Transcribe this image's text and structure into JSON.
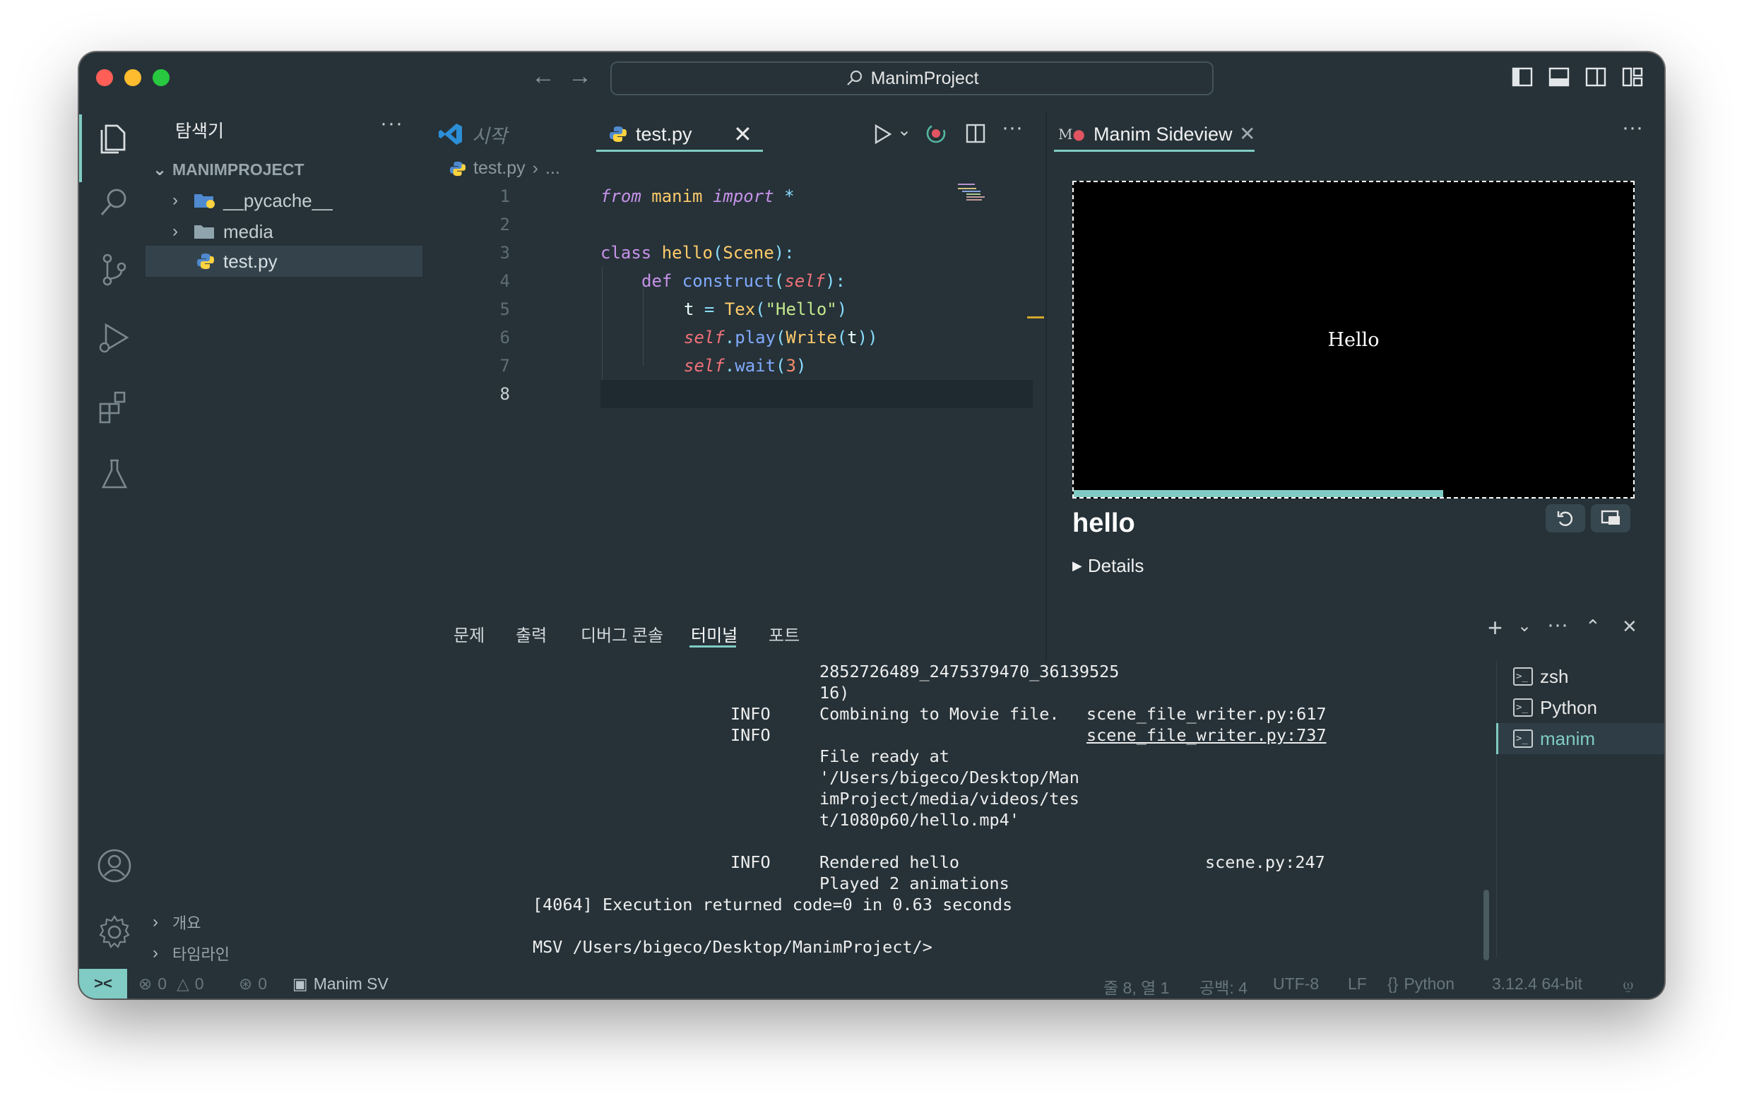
{
  "window": {
    "title": "ManimProject"
  },
  "explorer": {
    "title": "탐색기",
    "root": "MANIMPROJECT",
    "items": [
      {
        "label": "__pycache__",
        "type": "folder"
      },
      {
        "label": "media",
        "type": "folder"
      },
      {
        "label": "test.py",
        "type": "python-file"
      }
    ],
    "bottom_sections": [
      "개요",
      "타임라인"
    ]
  },
  "editor": {
    "tabs": [
      {
        "label": "시작"
      },
      {
        "label": "test.py"
      }
    ],
    "breadcrumb": {
      "file": "test.py",
      "rest": "..."
    },
    "line_numbers": [
      "1",
      "2",
      "3",
      "4",
      "5",
      "6",
      "7",
      "8"
    ],
    "code": {
      "l1": {
        "from": "from",
        "module": " manim ",
        "import": "import",
        "star": " *"
      },
      "l3": {
        "class": "class",
        "name": " hello",
        "open": "(",
        "base": "Scene",
        "close": "):"
      },
      "l4": {
        "def": "def",
        "name": " construct",
        "open": "(",
        "self": "self",
        "close": "):"
      },
      "l5": {
        "var": "t ",
        "eq": "=",
        "cls": " Tex",
        "open": "(",
        "str": "\"Hello\"",
        "close": ")"
      },
      "l6": {
        "self": "self",
        "dot": ".",
        "fn": "play",
        "open": "(",
        "cls": "Write",
        "open2": "(",
        "arg": "t",
        "close": "))"
      },
      "l7": {
        "self": "self",
        "dot": ".",
        "fn": "wait",
        "open": "(",
        "num": "3",
        "close": ")"
      }
    }
  },
  "sideview": {
    "tab_label": "Manim Sideview",
    "preview_text": "Hello",
    "scene_name": "hello",
    "details_label": "Details",
    "progress_fraction": 0.66
  },
  "panel": {
    "tabs": [
      "문제",
      "출력",
      "디버그 콘솔",
      "터미널",
      "포트"
    ],
    "active_tab": "터미널",
    "terminal_lines": {
      "l1": "2852726489_2475379470_36139525",
      "l2": "16)",
      "info1": "INFO",
      "msg1": "Combining to Movie file.",
      "src1": "scene_file_writer.py:617",
      "info2": "INFO",
      "src2": "scene_file_writer.py:737",
      "ready1": "File ready at",
      "ready2": "'/Users/bigeco/Desktop/Man",
      "ready3": "imProject/media/videos/tes",
      "ready4": "t/1080p60/hello.mp4'",
      "info3": "INFO",
      "msg3": "Rendered hello",
      "src3": "scene.py:247",
      "msg4": "Played 2 animations",
      "exec": "[4064] Execution returned code=0 in 0.63 seconds",
      "prompt": "MSV /Users/bigeco/Desktop/ManimProject/>"
    },
    "terminals": [
      "zsh",
      "Python",
      "manim"
    ]
  },
  "statusbar": {
    "errors": "0",
    "warnings": "0",
    "ports": "0",
    "manim": "Manim SV",
    "position": "줄 8, 열 1",
    "spaces": "공백: 4",
    "encoding": "UTF-8",
    "eol": "LF",
    "language": "Python",
    "interpreter": "3.12.4 64-bit"
  },
  "colors": {
    "background": "#263238",
    "accent": "#80cbc4",
    "close": "#ff5f57",
    "minimize": "#febc2e",
    "maximize": "#28c840"
  }
}
